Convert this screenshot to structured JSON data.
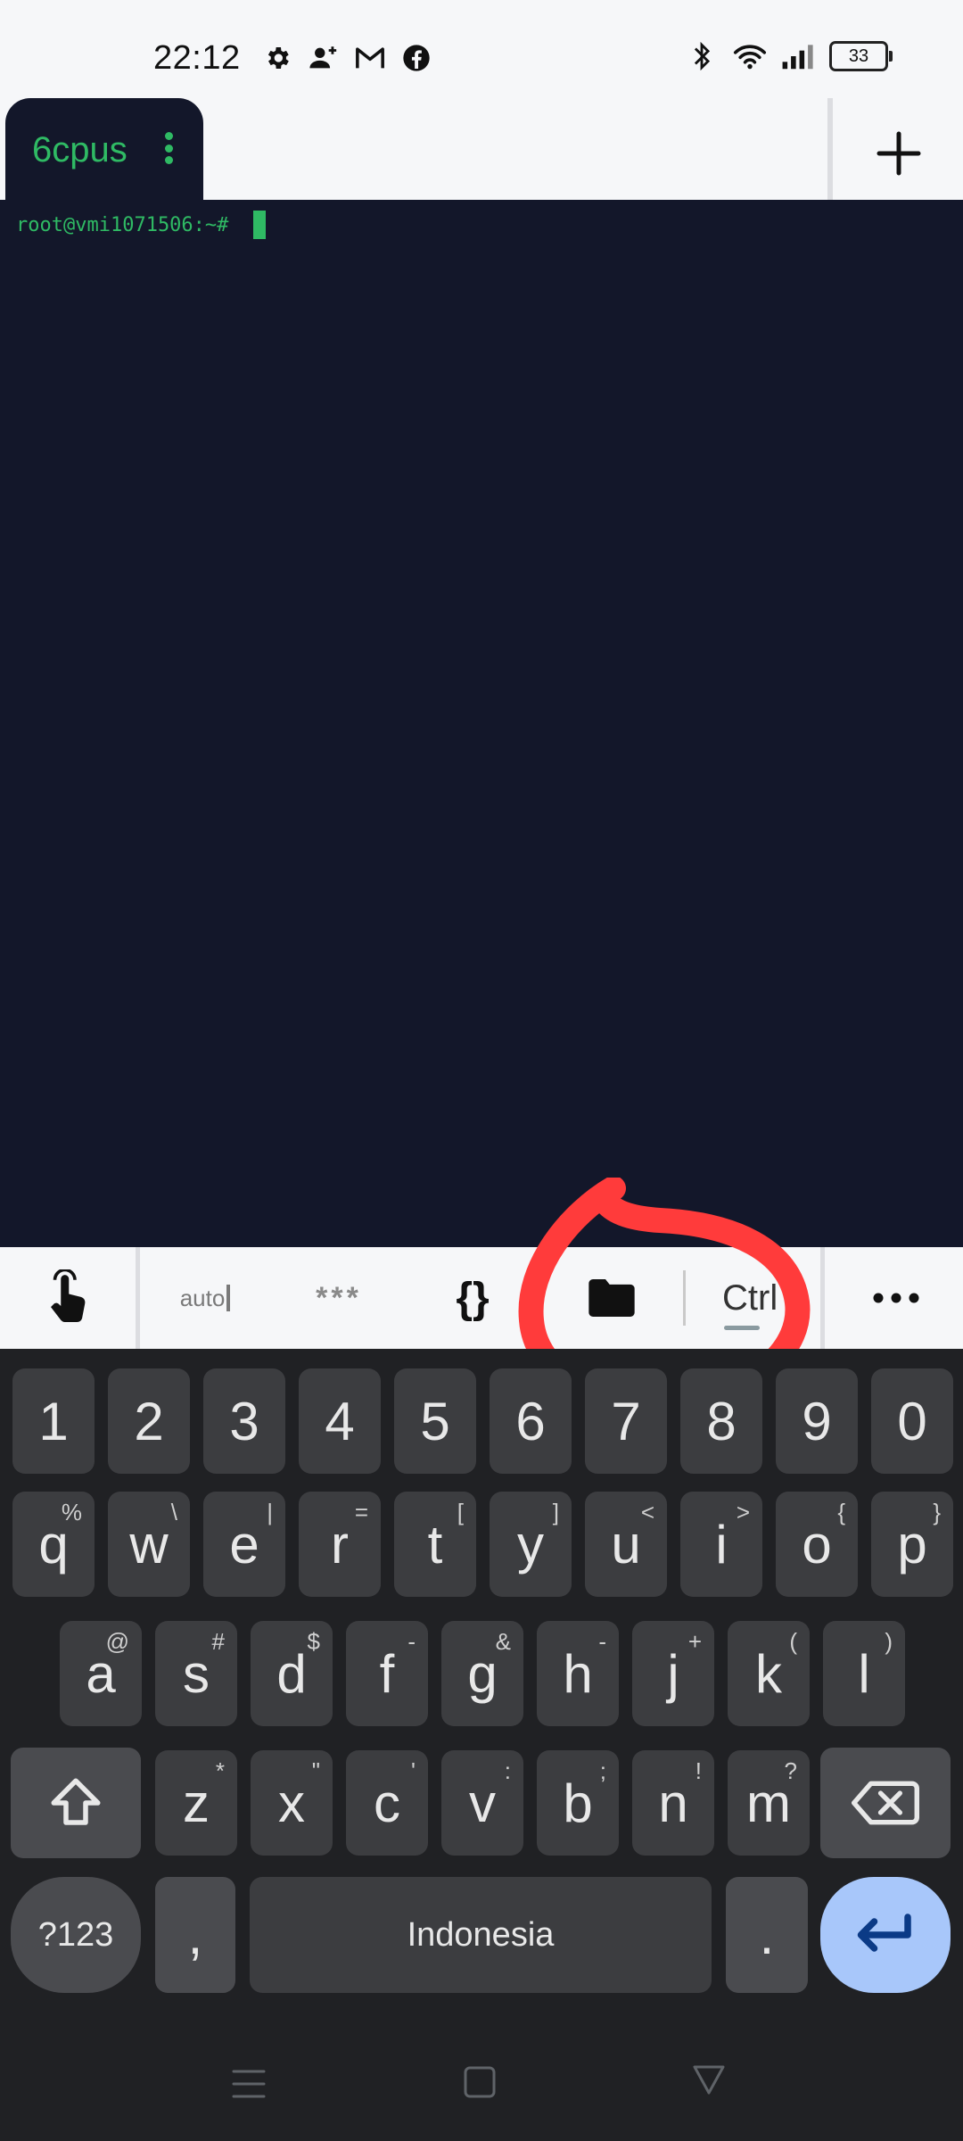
{
  "status_bar": {
    "time": "22:12",
    "battery": "33",
    "left_icons": [
      "settings-icon",
      "person-add-icon",
      "gmail-icon",
      "facebook-icon"
    ],
    "right_icons": [
      "bluetooth-icon",
      "wifi-icon",
      "signal-icon",
      "battery-icon"
    ]
  },
  "tabs": [
    {
      "label": "6cpus",
      "active": true
    }
  ],
  "terminal": {
    "prompt": "root@vmi1071506:~#",
    "colors": {
      "background": "#13172a",
      "text": "#2fba64"
    }
  },
  "toolbar": {
    "items": [
      {
        "name": "touch-icon"
      },
      {
        "label": "auto"
      },
      {
        "label": "***"
      },
      {
        "label": "{}"
      },
      {
        "name": "folder-icon"
      },
      {
        "label": "Ctrl"
      },
      {
        "name": "more-icon"
      }
    ]
  },
  "keyboard": {
    "number_row": [
      "1",
      "2",
      "3",
      "4",
      "5",
      "6",
      "7",
      "8",
      "9",
      "0"
    ],
    "row1": [
      {
        "k": "q",
        "s": "%"
      },
      {
        "k": "w",
        "s": "\\"
      },
      {
        "k": "e",
        "s": "|"
      },
      {
        "k": "r",
        "s": "="
      },
      {
        "k": "t",
        "s": "["
      },
      {
        "k": "y",
        "s": "]"
      },
      {
        "k": "u",
        "s": "<"
      },
      {
        "k": "i",
        "s": ">"
      },
      {
        "k": "o",
        "s": "{"
      },
      {
        "k": "p",
        "s": "}"
      }
    ],
    "row2": [
      {
        "k": "a",
        "s": "@"
      },
      {
        "k": "s",
        "s": "#"
      },
      {
        "k": "d",
        "s": "$"
      },
      {
        "k": "f",
        "s": "-"
      },
      {
        "k": "g",
        "s": "&"
      },
      {
        "k": "h",
        "s": "-"
      },
      {
        "k": "j",
        "s": "+"
      },
      {
        "k": "k",
        "s": "("
      },
      {
        "k": "l",
        "s": ")"
      }
    ],
    "row3": [
      {
        "k": "z",
        "s": "*"
      },
      {
        "k": "x",
        "s": "\""
      },
      {
        "k": "c",
        "s": "'"
      },
      {
        "k": "v",
        "s": ":"
      },
      {
        "k": "b",
        "s": ";"
      },
      {
        "k": "n",
        "s": "!"
      },
      {
        "k": "m",
        "s": "?"
      }
    ],
    "symbols_label": "?123",
    "comma": ",",
    "space_label": "Indonesia",
    "period": ".",
    "enter_color": "#a8c7fa"
  },
  "annotation_color": "#ff3b3b"
}
